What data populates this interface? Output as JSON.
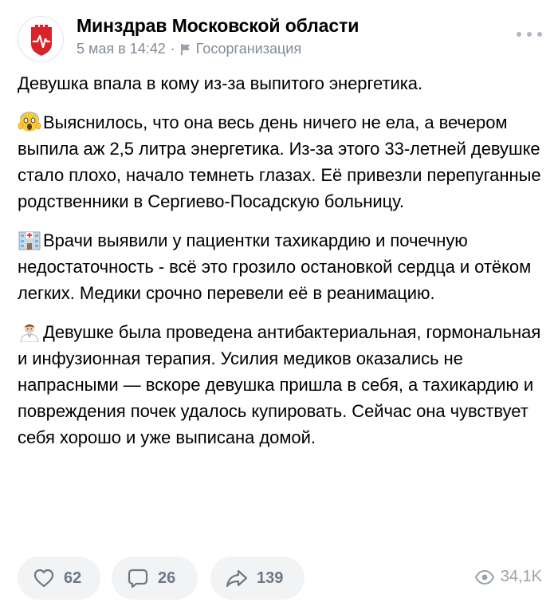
{
  "post": {
    "author": "Минздрав Московской области",
    "date": "5 мая в 14:42",
    "separator": "·",
    "type": "Госорганизация",
    "more_icon": "more-dots-icon",
    "paragraphs": [
      {
        "emoji": "",
        "text": "Девушка впала в кому из-за выпитого энергетика."
      },
      {
        "emoji": "face-screaming-in-fear",
        "text": "Выяснилось, что она весь день ничего не ела, а вечером выпила аж 2,5 литра энергетика. Из-за этого 33-летней девушке стало плохо, начало темнеть глазах. Её привезли перепуганные родственники в Сергиево-Посадскую больницу."
      },
      {
        "emoji": "hospital",
        "text": "Врачи выявили у пациентки тахикардию и почечную недостаточность - всё это грозило остановкой сердца и отёком легких. Медики срочно перевели её в реанимацию."
      },
      {
        "emoji": "man-health-worker",
        "text": "Девушке была проведена антибактериальная, гормональная и инфузионная терапия. Усилия медиков оказались не напрасными — вскоре девушка пришла в себя, а тахикардию и повреждения почек удалось купировать. Сейчас она чувствует себя хорошо и уже выписана домой."
      }
    ]
  },
  "footer": {
    "likes": "62",
    "comments": "26",
    "shares": "139",
    "views": "34,1K"
  },
  "colors": {
    "brand_red": "#d8232a",
    "meta_gray": "#818c99",
    "pill_bg": "#f2f3f5",
    "icon_gray": "#6d7885"
  }
}
